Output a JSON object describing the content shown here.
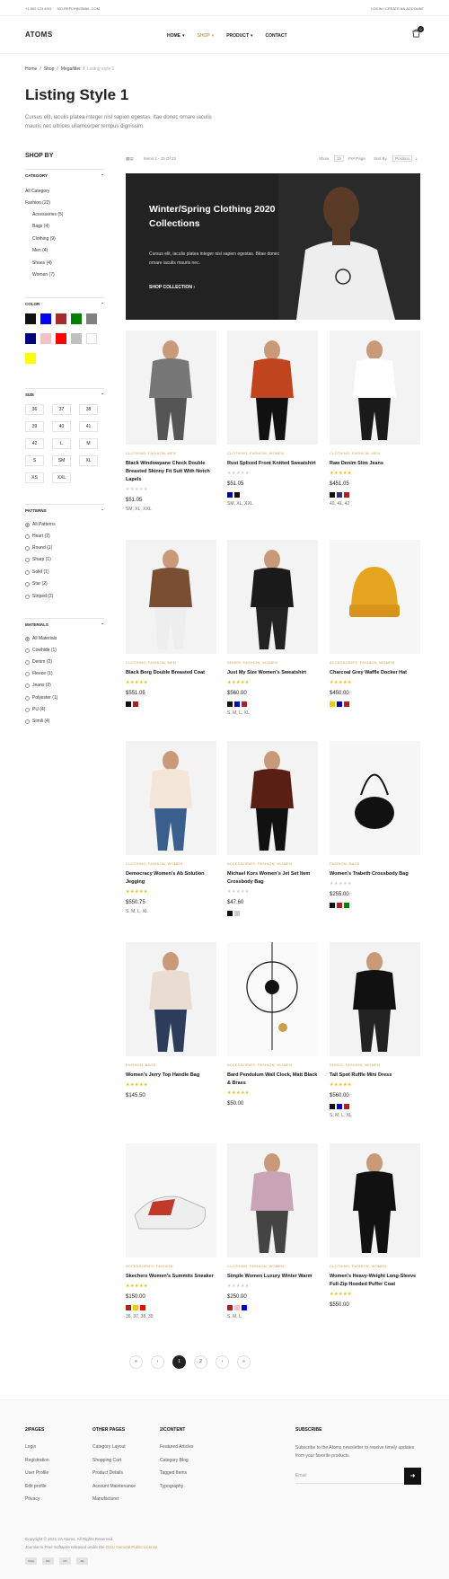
{
  "topbar": {
    "phone": "+1 800 123 4911",
    "email": "NO-REPLY@GMAIL.COM",
    "login": "LOGIN / CREATE AN ACCOUNT"
  },
  "logo": "ATOMS",
  "nav": [
    "HOME",
    "SHOP",
    "PRODUCT",
    "CONTACT"
  ],
  "cart_count": "0",
  "breadcrumb": [
    "Home",
    "Shop",
    "Megafilter",
    "Listing style 1"
  ],
  "page": {
    "title": "Listing Style 1",
    "desc": "Cursus elit, iaculis platea integer nisl sapien egestas. Itae donec ornare iaculis mauris nec ultrices ullamcorper tempus dignissim."
  },
  "sidebar": {
    "shop_by": "SHOP BY",
    "category_label": "CATEGORY",
    "categories_top": [
      "All Category",
      "Fashion (22)"
    ],
    "categories_sub": [
      "Accessories (5)",
      "Bags (4)",
      "Clothing (9)",
      "Men (4)",
      "Shoes (4)",
      "Women (7)"
    ],
    "color_label": "COLOR",
    "colors": [
      "#111111",
      "#0000ff",
      "#a52a2a",
      "#008000",
      "#808080",
      "#000080",
      "#f4c2c2",
      "#ff0000",
      "#c0c0c0",
      "#ffffff",
      "#ffff00"
    ],
    "size_label": "SIZE",
    "sizes": [
      "36",
      "37",
      "38",
      "39",
      "40",
      "41",
      "42",
      "L",
      "M",
      "S",
      "SM",
      "XL",
      "XS",
      "XXL"
    ],
    "patterns_label": "PATTERNS",
    "patterns": [
      "All Patterns",
      "Heart (2)",
      "Round (1)",
      "Sharp (1)",
      "Solid (1)",
      "Star (2)",
      "Striped (2)"
    ],
    "materials_label": "MATERIALS",
    "materials": [
      "All Materials",
      "Cowhide (1)",
      "Denim (2)",
      "Fleece (1)",
      "Jeans (2)",
      "Polyester (1)",
      "PU (4)",
      "Simili (4)"
    ]
  },
  "toolbar": {
    "items": "Items 1 - 15 Of 22",
    "show": "Show",
    "show_val": "15",
    "per_page": "Per Page",
    "sort_by": "Sort By",
    "sort_val": "Position"
  },
  "banner": {
    "title": "Winter/Spring Clothing 2020 Collections",
    "text": "Cursus elit, iaculis platea integer nisl sapien egestas. Bitae donec ornare iaculis mauris nec.",
    "button": "SHOP COLLECTION"
  },
  "products": [
    {
      "cat": "CLOTHING, FASHION, MEN",
      "name": "Black Windowpane Check Double Breasted Skinny Fit Suit With Notch Lapels",
      "stars": 0,
      "price": "$51.05",
      "colors": [],
      "sizes": "SM, XL, XXL"
    },
    {
      "cat": "CLOTHING, FASHION, WOMEN",
      "name": "Rust Spliced Front Knitted Sweatshirt",
      "stars": 0,
      "price": "$51.05",
      "colors": [
        "#0000aa",
        "#111111"
      ],
      "sizes": "SM, XL, XXL"
    },
    {
      "cat": "CLOTHING, FASHION, MEN",
      "name": "Raw Denim Slim Jeans",
      "stars": 5,
      "price": "$451.05",
      "colors": [
        "#111111",
        "#333377",
        "#aa2222"
      ],
      "sizes": "40, 41, 42"
    },
    {
      "cat": "CLOTHING, FASHION, MEN",
      "name": "Black Borg Double Breasted Coat",
      "stars": 5,
      "price": "$551.05",
      "colors": [
        "#111111",
        "#aa2222"
      ],
      "sizes": ""
    },
    {
      "cat": "SHOES, FASHION, WOMEN",
      "name": "Just My Size Women's Sweatshirt",
      "stars": 5,
      "price": "$560.00",
      "colors": [
        "#111111",
        "#0000cc",
        "#aa2222"
      ],
      "sizes": "S, M, L, XL"
    },
    {
      "cat": "ACCESSORIES, FASHION, WOMEN",
      "name": "Charcoal Grey Waffle Docker Hat",
      "stars": 5,
      "price": "$450.00",
      "colors": [
        "#eecc00",
        "#0000aa",
        "#aa2222"
      ],
      "sizes": ""
    },
    {
      "cat": "CLOTHING, FASHION, WOMEN",
      "name": "Democracy Women's Ab Solution Jegging",
      "stars": 5,
      "price": "$550.75",
      "colors": [],
      "sizes": "S, M, L, XL"
    },
    {
      "cat": "ACCESSORIES, FASHION, WOMEN",
      "name": "Michael Kors Women's Jet Set Item Crossbody Bag",
      "stars": 0,
      "price": "$47.60",
      "colors": [
        "#111111",
        "#cccccc"
      ],
      "sizes": ""
    },
    {
      "cat": "FASHION, BAGS",
      "name": "Women's Trabeth Crossbody Bag",
      "stars": 0,
      "price": "$255.00",
      "colors": [
        "#111111",
        "#aa2222",
        "#008000"
      ],
      "sizes": ""
    },
    {
      "cat": "FASHION, BAGS",
      "name": "Women's Jerry Top Handle Bag",
      "stars": 5,
      "price": "$145.50",
      "colors": [],
      "sizes": ""
    },
    {
      "cat": "ACCESSORIES, FASHION, WOMEN",
      "name": "Bard Pendulum Wall Clock, Matt Black & Brass",
      "stars": 5,
      "price": "$50.00",
      "colors": [],
      "sizes": ""
    },
    {
      "cat": "SHOES, FASHION, WOMEN",
      "name": "Tall Spot Ruffle Mini Dress",
      "stars": 5,
      "price": "$560.00",
      "colors": [
        "#111111",
        "#0000cc",
        "#aa2222"
      ],
      "sizes": "S, M, L, XL"
    },
    {
      "cat": "ACCESSORIES, FASHION",
      "name": "Skechers Women's Summits Sneaker",
      "stars": 5,
      "price": "$150.00",
      "colors": [
        "#aa2222",
        "#eecc00",
        "#ff0000"
      ],
      "sizes": "36, 37, 38, 39"
    },
    {
      "cat": "CLOTHING, FASHION, WOMEN",
      "name": "Simple Women Luxury Winter Warm",
      "stars": 0,
      "price": "$250.00",
      "colors": [
        "#aa2222",
        "#f4c2c2",
        "#0000cc"
      ],
      "sizes": "S, M, L"
    },
    {
      "cat": "CLOTHING, FASHION, WOMEN",
      "name": "Women's Heavy-Weight Long-Sleeve Full-Zip Hooded Puffer Coat",
      "stars": 5,
      "price": "$550.00",
      "colors": [],
      "sizes": ""
    }
  ],
  "pager": [
    "«",
    "‹",
    "1",
    "2",
    "›",
    "»"
  ],
  "footer": {
    "col1_title": "2/PAGES",
    "col1": [
      "Login",
      "Registration",
      "User Profile",
      "Edit profile",
      "Privacy"
    ],
    "col2_title": "OTHER PAGES",
    "col2": [
      "Category Layout",
      "Shopping Cart",
      "Product Details",
      "Account Maintenance",
      "Manufacturer"
    ],
    "col3_title": "2/CONTENT",
    "col3": [
      "Featured Articles",
      "Category Blog",
      "Tagged Items",
      "Typography"
    ],
    "sub_title": "SUBSCRIBE",
    "sub_text": "Subscribe to the Atoms newsletter to receive timely updates from your favorite products.",
    "email_ph": "Email",
    "copyright": "Copyright © 2021 2A Atoms. All Rights Reserved.",
    "license_pre": "Joomla! is Free Software released under the",
    "license_link": "GNU General Public License.",
    "pay": [
      "VISA",
      "MC",
      "PP",
      "AE"
    ]
  }
}
